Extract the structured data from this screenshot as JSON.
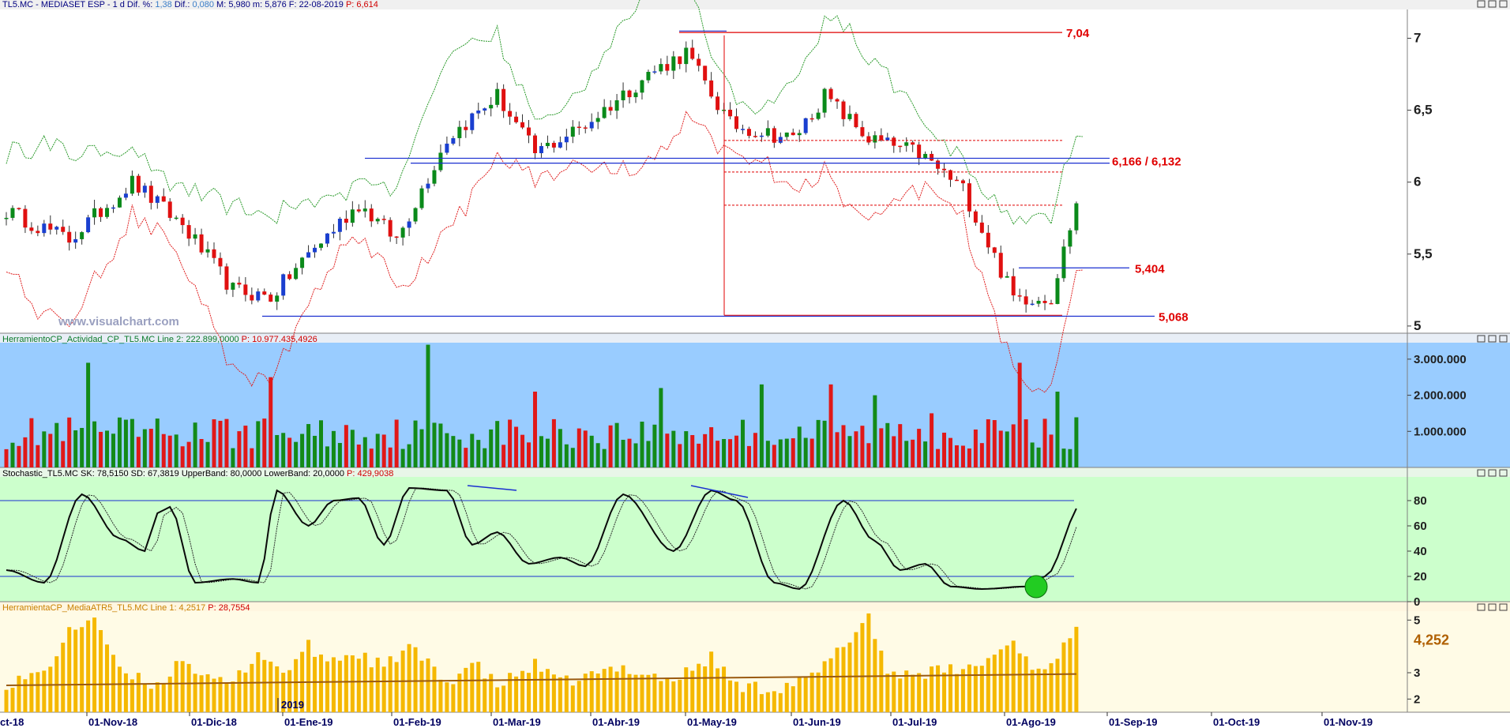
{
  "panels": {
    "price": {
      "header": [
        {
          "text": "TL5.MC - MEDIASET ESP -  1 d  Dif. %: ",
          "color": "#000080"
        },
        {
          "text": "1,38",
          "color": "#3a7dc8"
        },
        {
          "text": "  Dif.: ",
          "color": "#000080"
        },
        {
          "text": "0,080",
          "color": "#3a7dc8"
        },
        {
          "text": "  M: 5,980  m: 5,876  F: 22-08-2019  ",
          "color": "#000080"
        },
        {
          "text": "P: 6,614",
          "color": "#d00000"
        }
      ],
      "watermark": "www.visualchart.com",
      "yticks": [
        "7",
        "6,5",
        "6",
        "5,5",
        "5"
      ]
    },
    "volume": {
      "header": [
        {
          "text": "HerramientoCP_Actividad_CP_TL5.MC  ",
          "color": "#0a7a2a"
        },
        {
          "text": "Line 2: 222.899,0000",
          "color": "#0a7a2a"
        },
        {
          "text": "  P: 10.977.435,4926",
          "color": "#d00000"
        }
      ],
      "yticks": [
        "3.000.000",
        "2.000.000",
        "1.000.000"
      ]
    },
    "stochastic": {
      "header": [
        {
          "text": "Stochastic_TL5.MC  SK: 78,5150  SD: 67,3819  UpperBand: 80,0000  LowerBand: 20,0000  ",
          "color": "#000000"
        },
        {
          "text": "P: 429,9038",
          "color": "#d00000"
        }
      ],
      "yticks": [
        "80",
        "60",
        "40",
        "20",
        "0"
      ]
    },
    "atr": {
      "header": [
        {
          "text": "HerramientaCP_MediaATR5_TL5.MC  Line 1: 4,2517",
          "color": "#c88000"
        },
        {
          "text": "  P: 28,7554",
          "color": "#d00000"
        }
      ],
      "yticks": [
        "5",
        "3",
        "2"
      ],
      "last_value_label": "4,252"
    }
  },
  "price_levels": [
    {
      "label": "7,04",
      "color": "#e00000"
    },
    {
      "label": "6,166 / 6,132",
      "color": "#e00000"
    },
    {
      "label": "5,404",
      "color": "#e00000"
    },
    {
      "label": "5,068",
      "color": "#e00000"
    }
  ],
  "xaxis": {
    "labels": [
      "ct-18",
      "01-Nov-18",
      "01-Dic-18",
      "01-Ene-19",
      "01-Feb-19",
      "01-Mar-19",
      "01-Abr-19",
      "01-May-19",
      "01-Jun-19",
      "01-Jul-19",
      "01-Ago-19",
      "01-Sep-19",
      "01-Oct-19",
      "01-Nov-19"
    ],
    "year_marker": "2019"
  },
  "chart_data": [
    {
      "type": "candlestick",
      "title": "TL5.MC - MEDIASET ESP - 1 d",
      "ylim": [
        4.95,
        7.2
      ],
      "levels": [
        7.04,
        6.166,
        6.132,
        5.404,
        5.068
      ],
      "fib_levels": [
        6.29,
        6.07,
        5.84
      ],
      "last_bar": {
        "high": 5.98,
        "low": 5.876
      }
    },
    {
      "type": "bar",
      "title": "HerramientoCP_Actividad_CP_TL5.MC",
      "ylim": [
        0,
        3500000
      ],
      "notable_peaks": [
        2900000,
        2500000,
        3400000,
        2300000,
        2900000,
        2100000
      ]
    },
    {
      "type": "line",
      "title": "Stochastic_TL5.MC",
      "ylim": [
        0,
        100
      ],
      "series": [
        {
          "name": "SK",
          "last": 78.515
        },
        {
          "name": "SD",
          "last": 67.3819
        }
      ],
      "bands": [
        80,
        20
      ]
    },
    {
      "type": "bar",
      "title": "HerramientaCP_MediaATR5_TL5.MC",
      "ylim": [
        1.5,
        5.4
      ],
      "series": [
        {
          "name": "Line 1",
          "last": 4.2517
        }
      ]
    }
  ]
}
